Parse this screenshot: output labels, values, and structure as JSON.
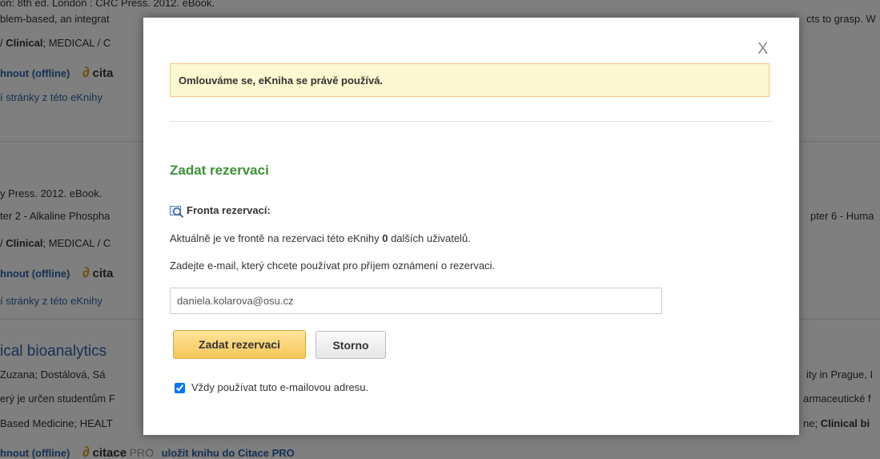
{
  "background": {
    "row1": {
      "line1": "on: 8th ed. London : CRC Press. 2012. eBook.",
      "line2": "blem-based, an integrat",
      "line2_right": "cts to grasp. W",
      "line3_a": "/ ",
      "line3_b": "Clinical",
      "line3_c": "; MEDICAL / C",
      "download": "hnout (offline)",
      "citace_mark": "∂",
      "citace_label": "cita",
      "pages": "í stránky z této eKnihy"
    },
    "row2": {
      "line1": "y Press. 2012. eBook.",
      "line2": "ter 2 - Alkaline Phospha",
      "line2_right": "pter 6 - Huma",
      "line3_a": "/ ",
      "line3_b": "Clinical",
      "line3_c": "; MEDICAL / C",
      "download": "hnout (offline)",
      "citace_mark": "∂",
      "citace_label": "cita",
      "pages": "í stránky z této eKnihy"
    },
    "row3": {
      "title": "ical bioanalytics",
      "line1": "Zuzana; Dostálová, Sá",
      "line1_right": "ity in Prague, I",
      "line2": "erý je určen studentům F",
      "line2_right": "armaceutické f",
      "line3": "Based Medicine; HEALT",
      "line3_right_a": "ne; ",
      "line3_right_b": "Clinical bi",
      "download": "hnout (offline)",
      "citace_mark": "∂",
      "citace_label": "citace",
      "citace_pro": "PRO",
      "save_link": "uložit knihu do Citace PRO"
    }
  },
  "modal": {
    "close_label": "X",
    "alert": "Omlouváme se, eKniha se právě používá.",
    "heading": "Zadat rezervaci",
    "queue_label": "Fronta rezervací:",
    "info_before": "Aktuálně je ve frontě na rezervaci této eKnihy ",
    "info_count": "0",
    "info_after": " dalších uživatelů.",
    "prompt": "Zadejte e-mail, který chcete používat pro příjem oznámení o rezervaci.",
    "email_value": "daniela.kolarova@osu.cz",
    "submit_label": "Zadat rezervaci",
    "cancel_label": "Storno",
    "always_label": "Vždy používat tuto e-mailovou adresu.",
    "always_checked": true
  },
  "colors": {
    "heading": "#3f8f3a",
    "alert_bg": "#fcf8d2",
    "link": "#2b63a8",
    "button": "#f6c75a"
  }
}
